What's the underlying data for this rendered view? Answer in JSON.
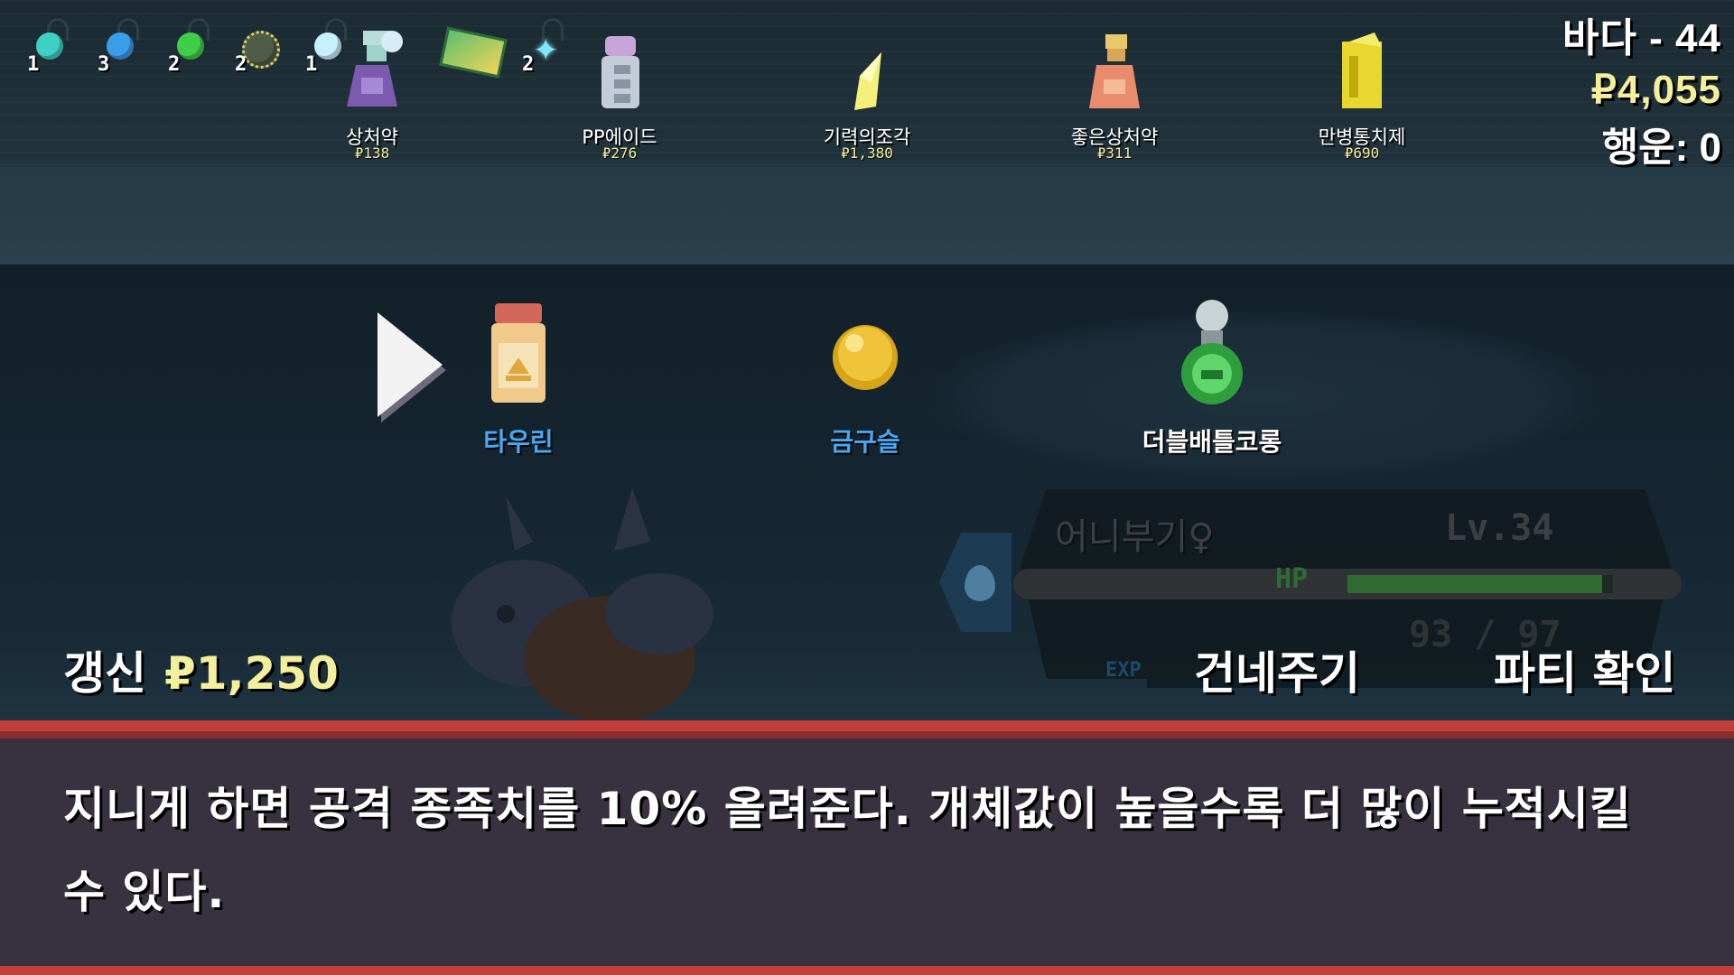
{
  "status": {
    "biome": "바다 - 44",
    "money": "₽4,055",
    "luck": "행운: 0"
  },
  "held_items": [
    {
      "name": "teal-gem-icon",
      "color": "#3fd0c5",
      "count": "1"
    },
    {
      "name": "blue-gem-icon",
      "color": "#3a9ee8",
      "count": "3"
    },
    {
      "name": "green-gem-icon",
      "color": "#3ecf4a",
      "count": "2"
    },
    {
      "name": "spiky-orb-icon",
      "color": "#5a6a55",
      "count": "2"
    },
    {
      "name": "white-gem-icon",
      "color": "#c8f0ff",
      "count": "1"
    },
    {
      "name": "map-icon",
      "color": "#5bbf6c",
      "count": ""
    },
    {
      "name": "sparkle-icon",
      "color": "#7fe7ff",
      "count": "2"
    }
  ],
  "shop_items": [
    {
      "name": "상처약",
      "price": "₽138",
      "icon": "potion-icon",
      "color": "#8a6bc0"
    },
    {
      "name": "PP에이드",
      "price": "₽276",
      "icon": "ppup-icon",
      "color": "#b9c4d6"
    },
    {
      "name": "기력의조각",
      "price": "₽1,380",
      "icon": "revive-shard-icon",
      "color": "#f2f07a"
    },
    {
      "name": "좋은상처약",
      "price": "₽311",
      "icon": "super-potion-icon",
      "color": "#e8a56a"
    },
    {
      "name": "만병통치제",
      "price": "₽690",
      "icon": "full-heal-icon",
      "color": "#f1e23a"
    }
  ],
  "rewards": [
    {
      "label": "타우린",
      "icon": "taurine-jar-icon",
      "color": "#4aa8f2"
    },
    {
      "label": "금구슬",
      "icon": "gold-ball-icon",
      "color": "#4aa8f2"
    },
    {
      "label": "더블배틀코롱",
      "icon": "double-battle-cologne-icon",
      "color": "#ffffff"
    }
  ],
  "pokemon": {
    "name": "어니부기♀",
    "level": "Lv.34",
    "hp_label": "HP",
    "hp_text": "93 / 97",
    "hp_fraction": 0.96,
    "exp_label": "EXP"
  },
  "buttons": {
    "refresh_label": "갱신",
    "refresh_cost": "₽1,250",
    "transfer_label": "건네주기",
    "party_label": "파티 확인"
  },
  "description": "지니게 하면 공격 종족치를 10% 올려준다. 개체값이 높을수록 더 많이 누적시킬 수 있다."
}
